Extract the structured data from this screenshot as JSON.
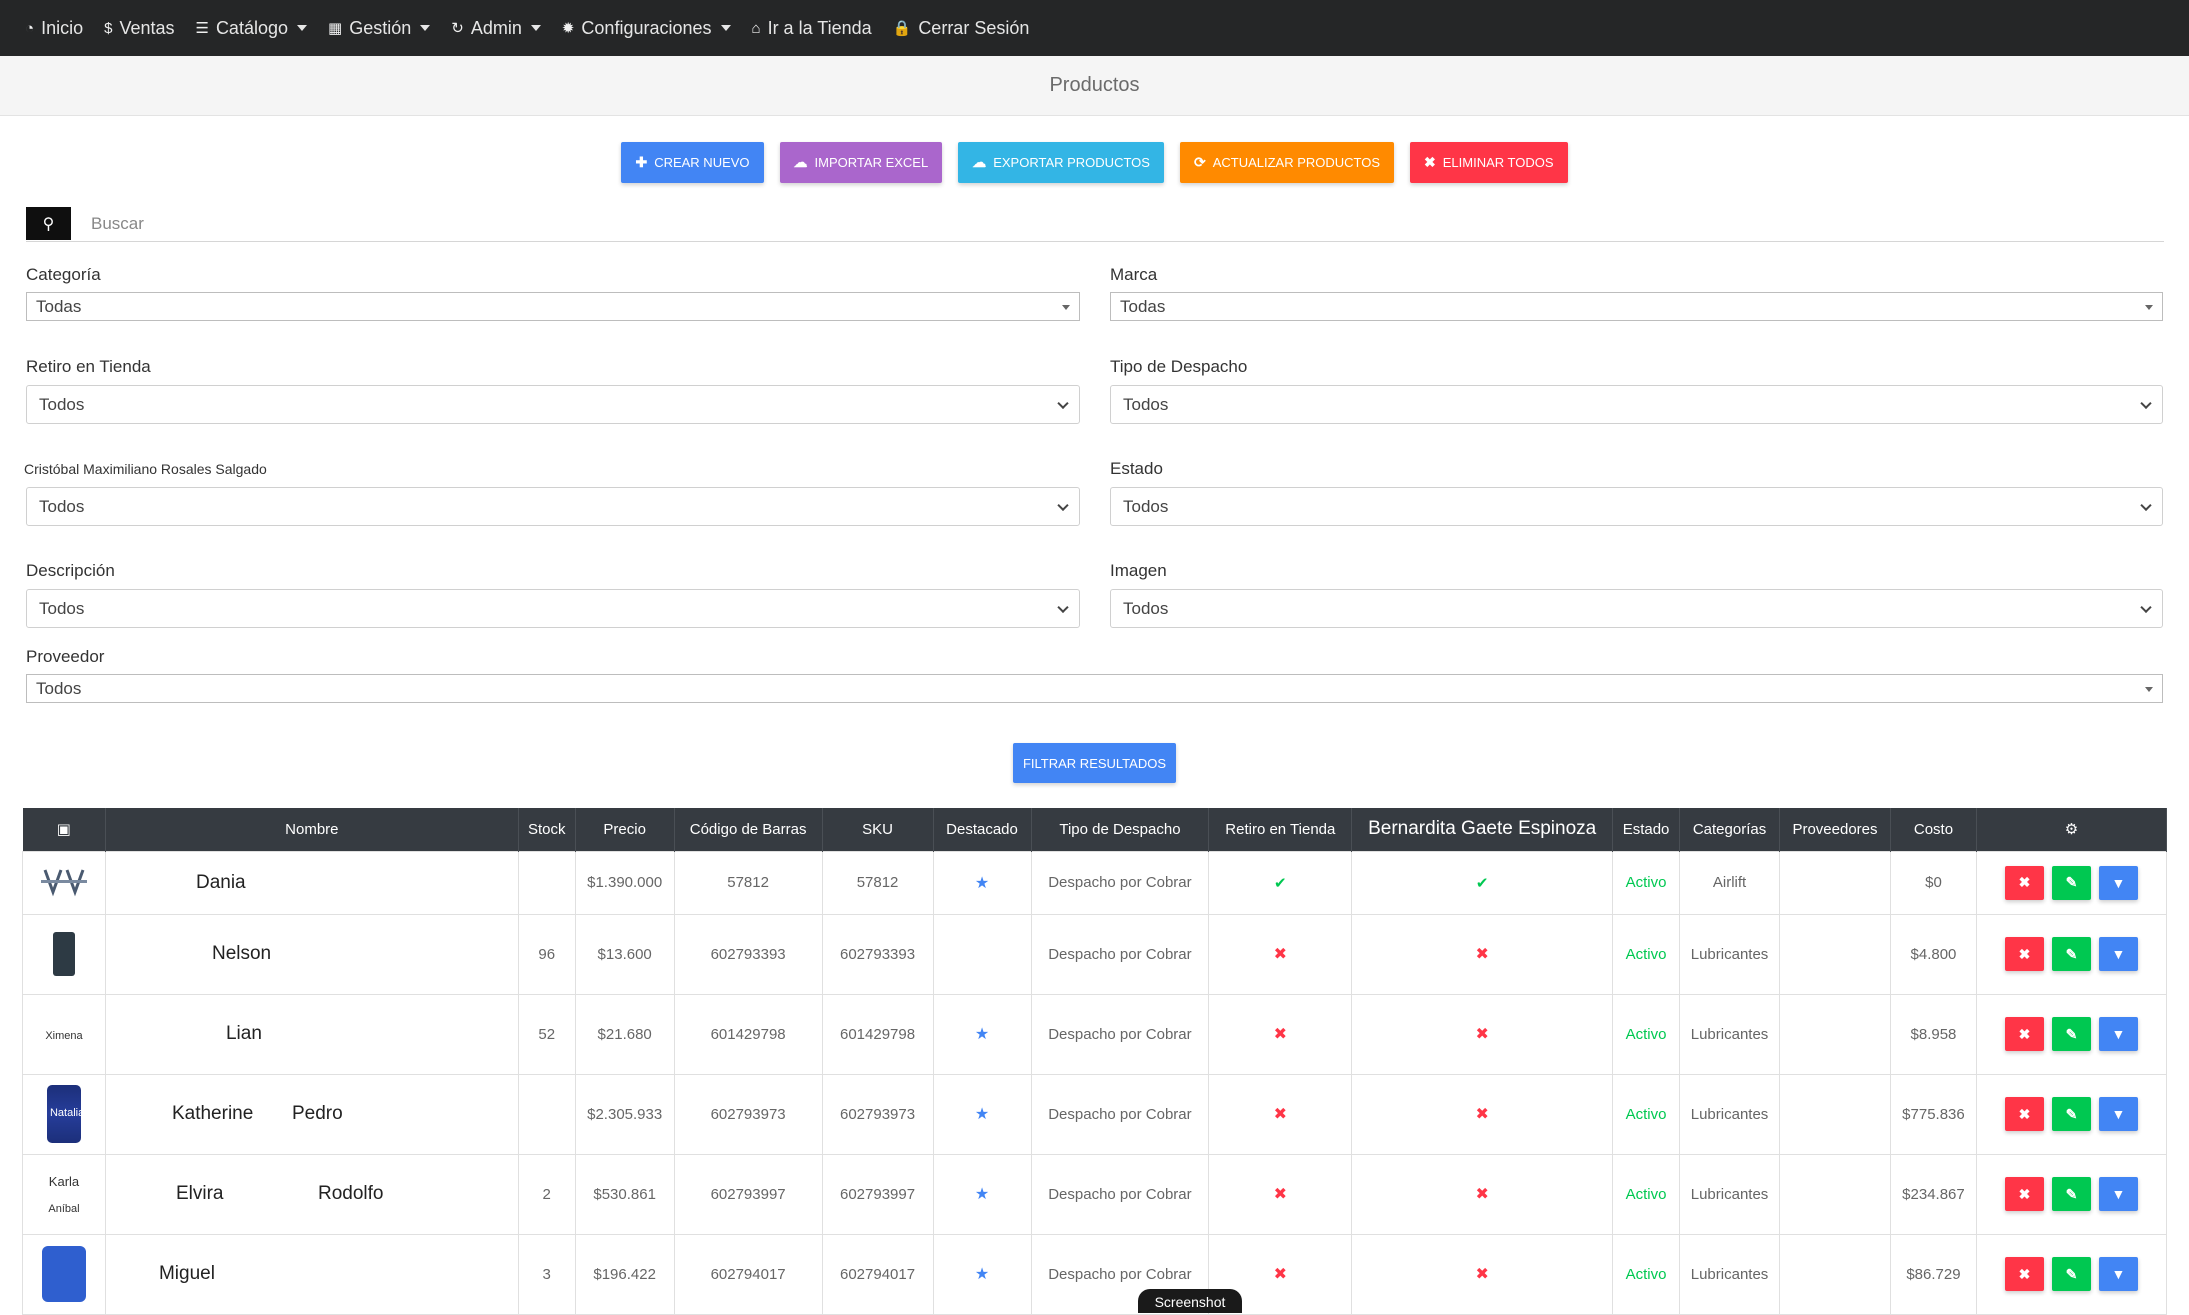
{
  "nav": [
    {
      "icon": "dashboard-icon",
      "glyph": "◔",
      "label": "Inicio",
      "dropdown": false
    },
    {
      "icon": "dollar-icon",
      "glyph": "$",
      "label": "Ventas",
      "dropdown": false
    },
    {
      "icon": "list-icon",
      "glyph": "☰",
      "label": "Catálogo",
      "dropdown": true
    },
    {
      "icon": "keyboard-icon",
      "glyph": "▦",
      "label": "Gestión",
      "dropdown": true
    },
    {
      "icon": "refresh-icon",
      "glyph": "↻",
      "label": "Admin",
      "dropdown": true
    },
    {
      "icon": "gear-icon",
      "glyph": "✹",
      "label": "Configuraciones",
      "dropdown": true
    },
    {
      "icon": "home-icon",
      "glyph": "⌂",
      "label": "Ir a la Tienda",
      "dropdown": false
    },
    {
      "icon": "lock-icon",
      "glyph": "🔒",
      "label": "Cerrar Sesión",
      "dropdown": false
    }
  ],
  "page_title": "Productos",
  "actions": {
    "create": "Crear nuevo",
    "import": "Importar Excel",
    "export": "Exportar productos",
    "update": "Actualizar productos",
    "delete_all": "Eliminar todos"
  },
  "search": {
    "placeholder": "Buscar"
  },
  "filters": {
    "categoria": {
      "label": "Categoría",
      "value": "Todas"
    },
    "marca": {
      "label": "Marca",
      "value": "Todas"
    },
    "retiro": {
      "label": "Retiro en Tienda",
      "value": "Todos"
    },
    "despacho": {
      "label": "Tipo de Despacho",
      "value": "Todos"
    },
    "persona": {
      "label": "Cristóbal Maximiliano Rosales Salgado",
      "value": "Todos"
    },
    "estado": {
      "label": "Estado",
      "value": "Todos"
    },
    "descripcion": {
      "label": "Descripción",
      "value": "Todos"
    },
    "imagen": {
      "label": "Imagen",
      "value": "Todos"
    },
    "proveedor": {
      "label": "Proveedor",
      "value": "Todos"
    }
  },
  "filter_button": "Filtrar resultados",
  "table": {
    "headers": {
      "image_icon": "image-icon",
      "nombre": "Nombre",
      "stock": "Stock",
      "precio": "Precio",
      "barcode": "Código de Barras",
      "sku": "SKU",
      "destacado": "Destacado",
      "despacho": "Tipo de Despacho",
      "retiro": "Retiro en Tienda",
      "persona": "Bernardita Gaete Espinoza",
      "estado": "Estado",
      "categorias": "Categorías",
      "proveedores": "Proveedores",
      "costo": "Costo",
      "actions_icon": "cogs-icon"
    },
    "rows": [
      {
        "thumb": "logo",
        "thumb_text": "",
        "thumb_text2": "",
        "name": "Dania",
        "name2": "",
        "stock": "",
        "precio": "$1.390.000",
        "barcode": "57812",
        "sku": "57812",
        "destacado": true,
        "despacho": "Despacho por Cobrar",
        "retiro": true,
        "persona": true,
        "estado": "Activo",
        "categoria": "Airlift",
        "proveedor": "",
        "costo": "$0"
      },
      {
        "thumb": "blk",
        "thumb_text": "",
        "thumb_text2": "",
        "name": "Nelson",
        "name2": "",
        "stock": "96",
        "precio": "$13.600",
        "barcode": "602793393",
        "sku": "602793393",
        "destacado": false,
        "despacho": "Despacho por Cobrar",
        "retiro": false,
        "persona": false,
        "estado": "Activo",
        "categoria": "Lubricantes",
        "proveedor": "",
        "costo": "$4.800"
      },
      {
        "thumb": "text",
        "thumb_text": "Ximena",
        "thumb_text2": "",
        "name": "Lian",
        "name2": "",
        "stock": "52",
        "precio": "$21.680",
        "barcode": "601429798",
        "sku": "601429798",
        "destacado": true,
        "despacho": "Despacho por Cobrar",
        "retiro": false,
        "persona": false,
        "estado": "Activo",
        "categoria": "Lubricantes",
        "proveedor": "",
        "costo": "$8.958"
      },
      {
        "thumb": "drum",
        "thumb_text": "Natalia",
        "thumb_text2": "",
        "name": "Katherine",
        "name2": "Pedro",
        "stock": "",
        "precio": "$2.305.933",
        "barcode": "602793973",
        "sku": "602793973",
        "destacado": true,
        "despacho": "Despacho por Cobrar",
        "retiro": false,
        "persona": false,
        "estado": "Activo",
        "categoria": "Lubricantes",
        "proveedor": "",
        "costo": "$775.836"
      },
      {
        "thumb": "text2",
        "thumb_text": "Karla",
        "thumb_text2": "Aníbal",
        "name": "Elvira",
        "name2": "Rodolfo",
        "stock": "2",
        "precio": "$530.861",
        "barcode": "602793997",
        "sku": "602793997",
        "destacado": true,
        "despacho": "Despacho por Cobrar",
        "retiro": false,
        "persona": false,
        "estado": "Activo",
        "categoria": "Lubricantes",
        "proveedor": "",
        "costo": "$234.867"
      },
      {
        "thumb": "jug",
        "thumb_text": "",
        "thumb_text2": "",
        "name": "Miguel",
        "name2": "",
        "stock": "3",
        "precio": "$196.422",
        "barcode": "602794017",
        "sku": "602794017",
        "destacado": true,
        "despacho": "Despacho por Cobrar",
        "retiro": false,
        "persona": false,
        "estado": "Activo",
        "categoria": "Lubricantes",
        "proveedor": "",
        "costo": "$86.729"
      }
    ]
  },
  "watermark": "Screenshot"
}
